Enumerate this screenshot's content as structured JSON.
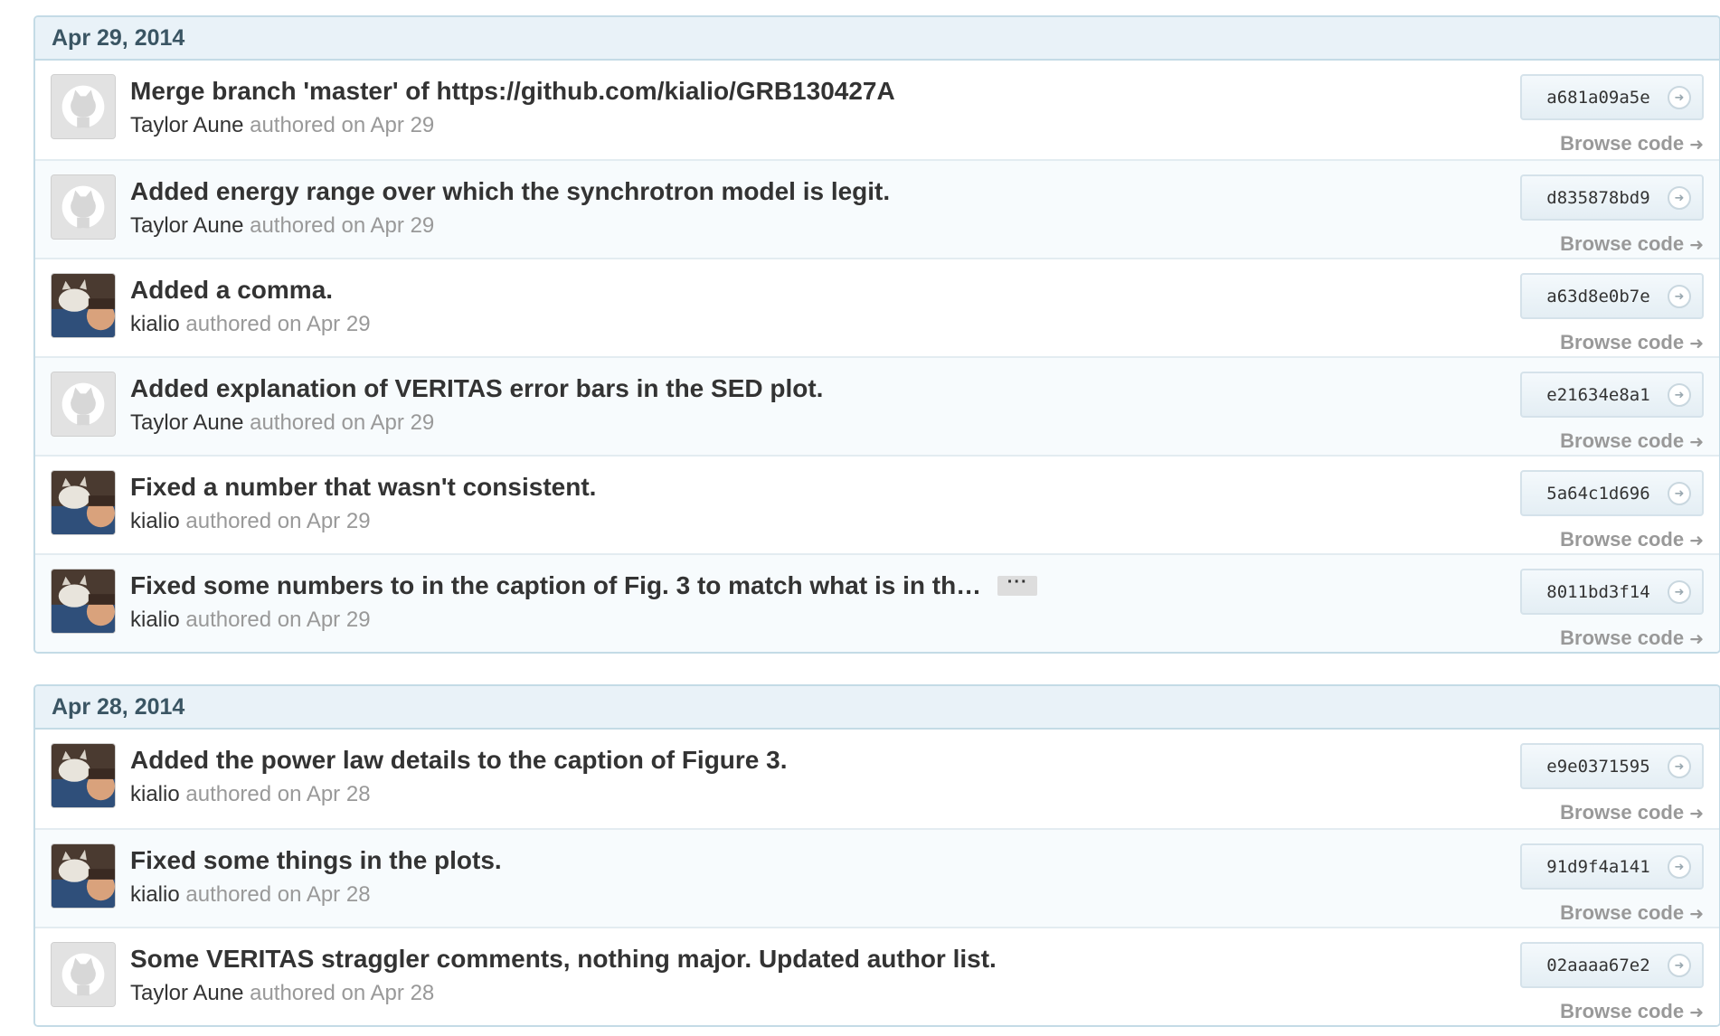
{
  "groups": [
    {
      "date": "Apr 29, 2014",
      "commits": [
        {
          "title": "Merge branch 'master' of https://github.com/kialio/GRB130427A",
          "author": "Taylor Aune",
          "authored_text": "authored on Apr 29",
          "sha": "a681a09a5e",
          "browse": "Browse code",
          "avatar": "identicon-avatar",
          "truncated": false
        },
        {
          "title": "Added energy range over which the synchrotron model is legit.",
          "author": "Taylor Aune",
          "authored_text": "authored on Apr 29",
          "sha": "d835878bd9",
          "browse": "Browse code",
          "avatar": "identicon-avatar",
          "truncated": false
        },
        {
          "title": "Added a comma.",
          "author": "kialio",
          "authored_text": "authored on Apr 29",
          "sha": "a63d8e0b7e",
          "browse": "Browse code",
          "avatar": "photo-avatar",
          "truncated": false
        },
        {
          "title": "Added explanation of VERITAS error bars in the SED plot.",
          "author": "Taylor Aune",
          "authored_text": "authored on Apr 29",
          "sha": "e21634e8a1",
          "browse": "Browse code",
          "avatar": "identicon-avatar",
          "truncated": false
        },
        {
          "title": "Fixed a number that wasn't consistent.",
          "author": "kialio",
          "authored_text": "authored on Apr 29",
          "sha": "5a64c1d696",
          "browse": "Browse code",
          "avatar": "photo-avatar",
          "truncated": false
        },
        {
          "title": "Fixed some numbers to in the caption of Fig. 3 to match what is in th…",
          "author": "kialio",
          "authored_text": "authored on Apr 29",
          "sha": "8011bd3f14",
          "browse": "Browse code",
          "avatar": "photo-avatar",
          "truncated": true
        }
      ]
    },
    {
      "date": "Apr 28, 2014",
      "commits": [
        {
          "title": "Added the power law details to the caption of Figure 3.",
          "author": "kialio",
          "authored_text": "authored on Apr 28",
          "sha": "e9e0371595",
          "browse": "Browse code",
          "avatar": "photo-avatar",
          "truncated": false
        },
        {
          "title": "Fixed some things in the plots.",
          "author": "kialio",
          "authored_text": "authored on Apr 28",
          "sha": "91d9f4a141",
          "browse": "Browse code",
          "avatar": "photo-avatar",
          "truncated": false
        },
        {
          "title": "Some VERITAS straggler comments, nothing major. Updated author list.",
          "author": "Taylor Aune",
          "authored_text": "authored on Apr 28",
          "sha": "02aaaa67e2",
          "browse": "Browse code",
          "avatar": "identicon-avatar",
          "truncated": false
        }
      ]
    }
  ],
  "ellipsis_label": "···",
  "icons": {
    "sha_arrow": "arrow-right-circle-icon",
    "browse_arrow": "arrow-right-icon"
  },
  "colors": {
    "header_bg": "#e9f2f8",
    "border": "#c4dbe6",
    "muted_text": "#999999",
    "main_text": "#333333"
  }
}
